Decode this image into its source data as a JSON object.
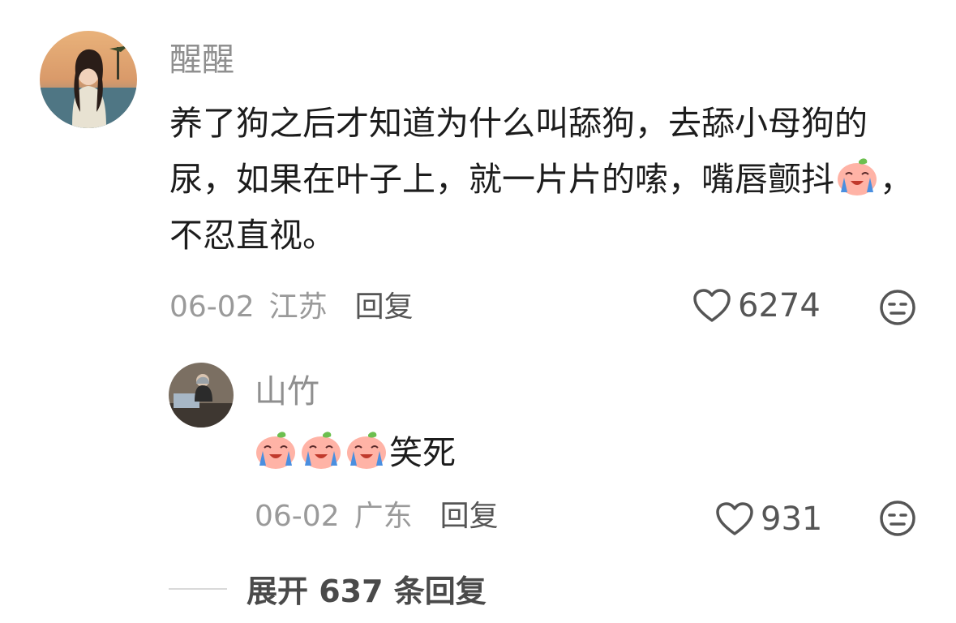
{
  "comment": {
    "username": "醒醒",
    "text_before_emoji": "养了狗之后才知道为什么叫舔狗，去舔小母狗的尿，如果在叶子上，就一片片的嗦，嘴唇颤抖",
    "emoji": "crying-laughing-peach-emoji",
    "text_after_emoji": "，不忍直视。",
    "date": "06-02",
    "location": "江苏",
    "reply_label": "回复",
    "like_count": "6274"
  },
  "reply": {
    "username": "山竹",
    "emojis": [
      "crying-laughing-peach-emoji",
      "crying-laughing-peach-emoji",
      "crying-laughing-peach-emoji"
    ],
    "text": "笑死",
    "date": "06-02",
    "location": "广东",
    "reply_label": "回复",
    "like_count": "931"
  },
  "expand": {
    "label": "展开 637 条回复"
  },
  "colors": {
    "username": "#8f8f8f",
    "meta": "#9a9a9a",
    "text": "#1c1c1c",
    "icon": "#555555"
  }
}
